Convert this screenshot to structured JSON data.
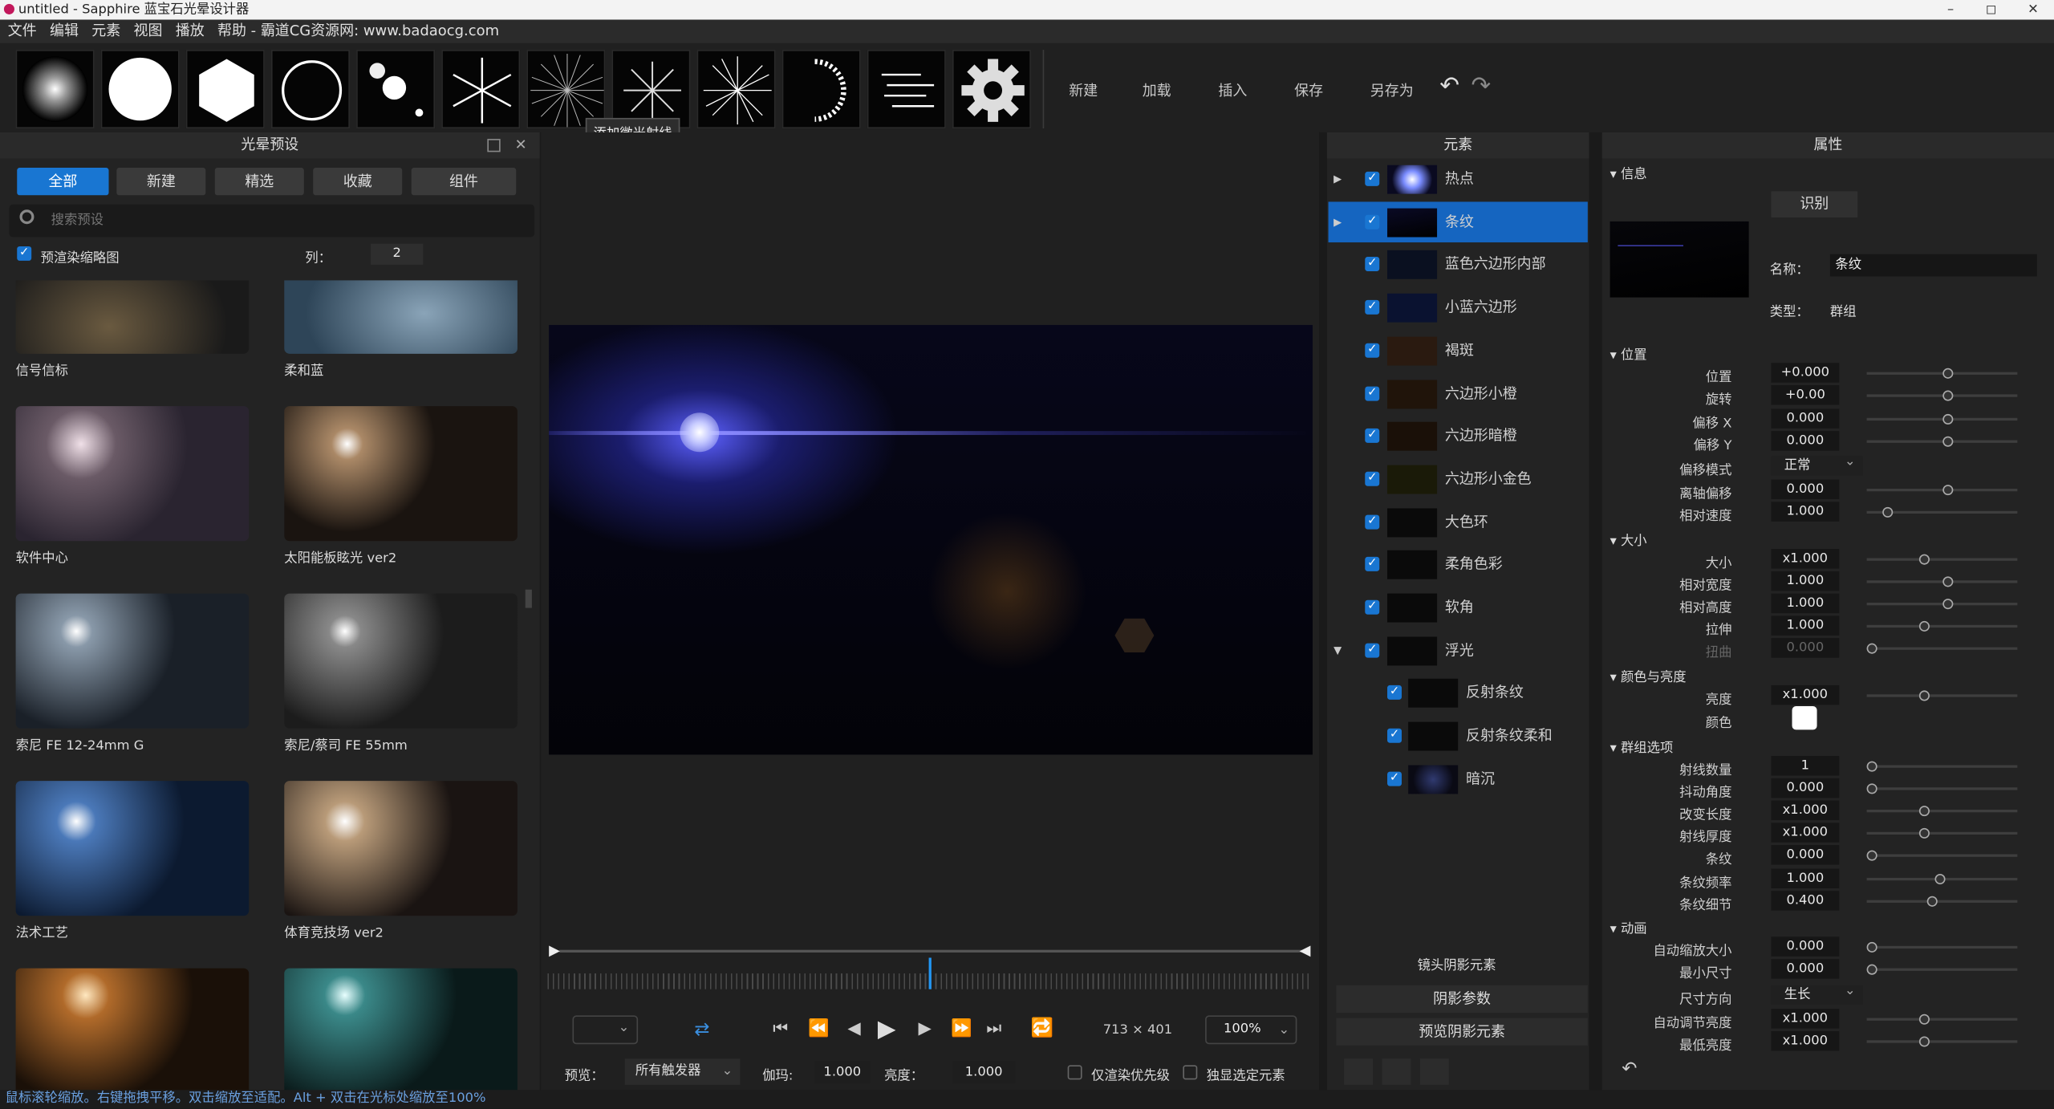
{
  "window": {
    "title": "untitled - Sapphire 蓝宝石光晕设计器",
    "min": "–",
    "max": "◻",
    "close": "✕"
  },
  "menu": [
    "文件",
    "编辑",
    "元素",
    "视图",
    "播放",
    "帮助 - 霸道CG资源网: www.badaocg.com"
  ],
  "toolbar": {
    "buttons": [
      "新建",
      "加载",
      "插入",
      "保存",
      "另存为"
    ],
    "tooltip": "添加微光射线",
    "undo": "↶",
    "redo": "↷"
  },
  "presets": {
    "title": "光晕预设",
    "tabs": [
      "全部",
      "新建",
      "精选",
      "收藏",
      "组件"
    ],
    "search_placeholder": "搜索预设",
    "render_thumbs": "预渲染缩略图",
    "cols_label": "列：",
    "cols_value": "2",
    "items": [
      "信号信标",
      "柔和蓝",
      "软件中心",
      "太阳能板眩光 ver2",
      "索尼 FE 12-24mm G",
      "索尼/蔡司 FE 55mm",
      "法术工艺",
      "体育竞技场 ver2",
      "",
      ""
    ]
  },
  "elements": {
    "title": "元素",
    "rows": [
      {
        "name": "热点",
        "expand": "▶"
      },
      {
        "name": "条纹",
        "expand": "▶"
      },
      {
        "name": "蓝色六边形内部",
        "expand": ""
      },
      {
        "name": "小蓝六边形",
        "expand": ""
      },
      {
        "name": "褐斑",
        "expand": ""
      },
      {
        "name": "六边形小橙",
        "expand": ""
      },
      {
        "name": "六边形暗橙",
        "expand": ""
      },
      {
        "name": "六边形小金色",
        "expand": ""
      },
      {
        "name": "大色环",
        "expand": ""
      },
      {
        "name": "柔角色彩",
        "expand": ""
      },
      {
        "name": "软角",
        "expand": ""
      },
      {
        "name": "浮光",
        "expand": "▼"
      },
      {
        "name": "反射条纹",
        "expand": ""
      },
      {
        "name": "反射条纹柔和",
        "expand": ""
      },
      {
        "name": "暗沉",
        "expand": ""
      }
    ],
    "lens_shadow": "镜头阴影元素",
    "shadow_params": "阴影参数",
    "preview_shadow": "预览阴影元素"
  },
  "props": {
    "title": "属性",
    "info": "信息",
    "identify": "识别",
    "name_label": "名称：",
    "name_value": "条纹",
    "type_label": "类型：",
    "type_value": "群组",
    "sections": {
      "position": "位置",
      "size": "大小",
      "color": "颜色与亮度",
      "group": "群组选项",
      "anim": "动画"
    },
    "rows": [
      {
        "label": "位置",
        "value": "+0.000",
        "pos": 0.5
      },
      {
        "label": "旋转",
        "value": "+0.00",
        "pos": 0.5
      },
      {
        "label": "偏移 X",
        "value": "0.000",
        "pos": 0.5
      },
      {
        "label": "偏移 Y",
        "value": "0.000",
        "pos": 0.5
      },
      {
        "label": "偏移模式",
        "value": "正常",
        "pos": null
      },
      {
        "label": "离轴偏移",
        "value": "0.000",
        "pos": 0.5
      },
      {
        "label": "相对速度",
        "value": "1.000",
        "pos": 0.1
      },
      {
        "label": "大小",
        "value": "x1.000",
        "pos": 0.35
      },
      {
        "label": "相对宽度",
        "value": "1.000",
        "pos": 0.5
      },
      {
        "label": "相对高度",
        "value": "1.000",
        "pos": 0.5
      },
      {
        "label": "拉伸",
        "value": "1.000",
        "pos": 0.35
      },
      {
        "label": "扭曲",
        "value": "0.000",
        "pos": 0
      },
      {
        "label": "亮度",
        "value": "x1.000",
        "pos": 0.35
      },
      {
        "label": "颜色",
        "value": "",
        "pos": null
      },
      {
        "label": "射线数量",
        "value": "1",
        "pos": 0
      },
      {
        "label": "抖动角度",
        "value": "0.000",
        "pos": 0
      },
      {
        "label": "改变长度",
        "value": "x1.000",
        "pos": 0.35
      },
      {
        "label": "射线厚度",
        "value": "x1.000",
        "pos": 0.35
      },
      {
        "label": "条纹",
        "value": "0.000",
        "pos": 0
      },
      {
        "label": "条纹频率",
        "value": "1.000",
        "pos": 0.45
      },
      {
        "label": "条纹细节",
        "value": "0.400",
        "pos": 0.4
      },
      {
        "label": "自动缩放大小",
        "value": "0.000",
        "pos": 0
      },
      {
        "label": "最小尺寸",
        "value": "0.000",
        "pos": 0
      },
      {
        "label": "尺寸方向",
        "value": "生长",
        "pos": null
      },
      {
        "label": "自动调节亮度",
        "value": "x1.000",
        "pos": 0.35
      },
      {
        "label": "最低亮度",
        "value": "x1.000",
        "pos": 0.35
      }
    ]
  },
  "viewer": {
    "size": "713 × 401",
    "zoom": "100%",
    "preview_label": "预览：",
    "preview_value": "所有触发器",
    "gamma_label": "伽玛:",
    "gamma_value": "1.000",
    "bright_label": "亮度：",
    "bright_value": "1.000",
    "only_render": "仅渲染优先级",
    "solo": "独显选定元素"
  },
  "status": "鼠标滚轮缩放。右键拖拽平移。双击缩放至适配。Alt + 双击在光标处缩放至100%"
}
